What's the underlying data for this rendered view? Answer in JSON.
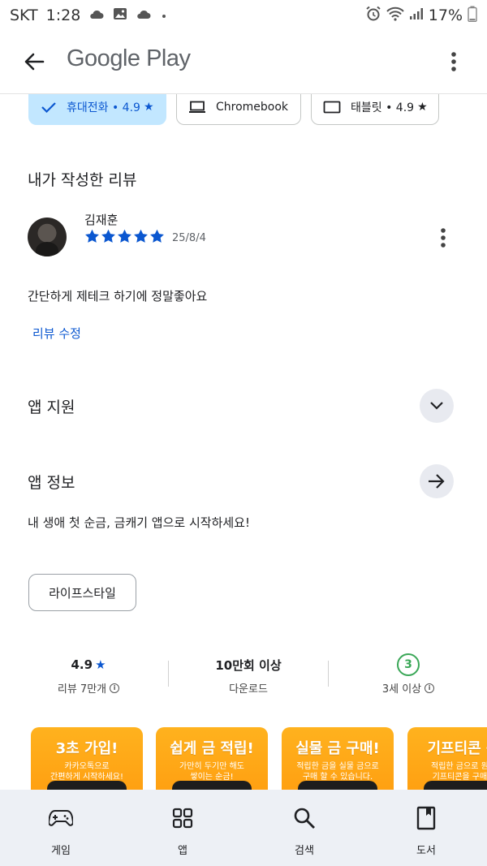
{
  "status_bar": {
    "carrier": "SKT",
    "time": "1:28",
    "battery": "17%"
  },
  "app_bar": {
    "brand": "Google Play"
  },
  "device_chips": [
    {
      "label": "휴대전화 • 4.9",
      "selected": true,
      "icon": "check-icon",
      "star": true
    },
    {
      "label": "Chromebook",
      "selected": false,
      "icon": "laptop-icon",
      "star": false
    },
    {
      "label": "태블릿 • 4.9",
      "selected": false,
      "icon": "tablet-icon",
      "star": true
    }
  ],
  "my_review": {
    "title": "내가 작성한 리뷰",
    "reviewer": "김재훈",
    "rating": 5,
    "date": "25/8/4",
    "text": "간단하게 제테크 하기에 정말좋아요",
    "edit_label": "리뷰 수정"
  },
  "app_support": {
    "title": "앱 지원"
  },
  "about": {
    "title": "앱 정보",
    "description": "내 생애 첫 순금, 금캐기 앱으로 시작하세요!",
    "category": "라이프스타일"
  },
  "stats": {
    "rating_value": "4.9",
    "rating_label": "리뷰 7만개",
    "downloads_value": "10만회 이상",
    "downloads_label": "다운로드",
    "age_value": "3",
    "age_label": "3세 이상"
  },
  "screenshots": [
    {
      "title": "3초 가입!",
      "sub1": "카카오톡으로",
      "sub2": "간편하게 시작하세요!"
    },
    {
      "title": "쉽게 금 적립!",
      "sub1": "가만히 두기만 해도",
      "sub2": "쌓이는 순금!"
    },
    {
      "title": "실물 금 구매!",
      "sub1": "적립한 금을 실물 금으로",
      "sub2": "구매 할 수 있습니다."
    },
    {
      "title": "기프티콘 구",
      "sub1": "적립한 금으로 원하",
      "sub2": "기프티콘을 구매하"
    }
  ],
  "bottom_nav": {
    "games": "게임",
    "apps": "앱",
    "search": "검색",
    "books": "도서"
  },
  "colors": {
    "accent_blue": "#0b57d0",
    "chip_selected_bg": "#c2e7ff",
    "age_green": "#3aa757",
    "nav_bg": "#edf0f5",
    "shot_orange": "#ffa51a"
  }
}
